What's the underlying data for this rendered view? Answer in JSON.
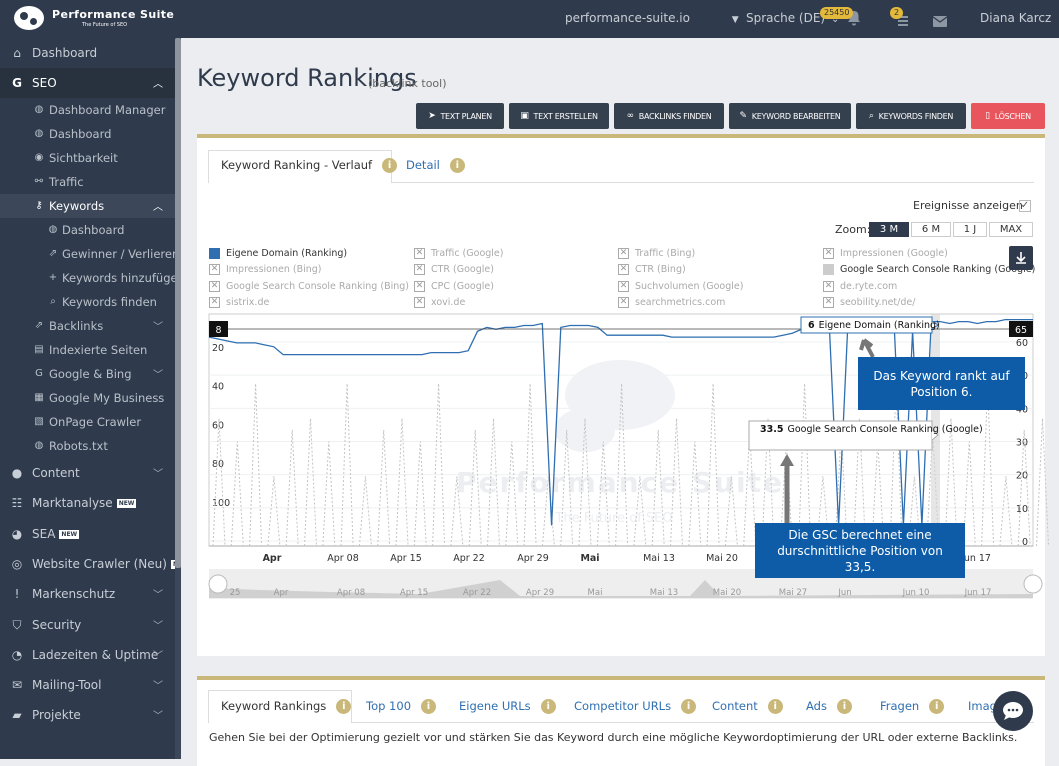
{
  "topbar": {
    "logo_title": "Performance Suite",
    "logo_sub": "The Future of SEO",
    "domain": "performance-suite.io",
    "language": "Sprache (DE)",
    "notif_count": "25450",
    "task_count": "2",
    "user": "Diana Karcz"
  },
  "sidebar": {
    "dashboard": "Dashboard",
    "seo": "SEO",
    "seo_items": [
      "Dashboard Manager",
      "Dashboard",
      "Sichtbarkeit",
      "Traffic",
      "Keywords"
    ],
    "keyword_items": [
      "Dashboard",
      "Gewinner / Verlierer",
      "Keywords hinzufügen",
      "Keywords finden"
    ],
    "seo_items2": [
      "Backlinks",
      "Indexierte Seiten",
      "Google & Bing",
      "Google My Business",
      "OnPage Crawler",
      "Robots.txt"
    ],
    "main_items": [
      "Content",
      "Marktanalyse",
      "SEA",
      "Website Crawler (Neu)",
      "Markenschutz",
      "Security",
      "Ladezeiten & Uptime",
      "Mailing-Tool",
      "Projekte"
    ],
    "new_label": "NEW"
  },
  "page": {
    "title": "Keyword Rankings",
    "subtitle": "(backlink tool)"
  },
  "toolbar": {
    "buttons": [
      "TEXT PLANEN",
      "TEXT ERSTELLEN",
      "BACKLINKS FINDEN",
      "KEYWORD BEARBEITEN",
      "KEYWORDS FINDEN",
      "LÖSCHEN"
    ],
    "delete_color": "#e8555c"
  },
  "card1": {
    "tabs": [
      "Keyword Ranking - Verlauf",
      "Detail"
    ],
    "events_label": "Ereignisse anzeigen",
    "zoom_label": "Zoom:",
    "zoom_options": [
      "3 M",
      "6 M",
      "1 J",
      "MAX"
    ],
    "zoom_selected": "3 M",
    "legend": [
      [
        "Eigene Domain (Ranking)",
        "Traffic (Google)",
        "Traffic (Bing)",
        "Impressionen (Google)"
      ],
      [
        "Impressionen (Bing)",
        "CTR (Google)",
        "CTR (Bing)",
        "Google Search Console Ranking (Google)"
      ],
      [
        "Google Search Console Ranking (Bing)",
        "CPC (Google)",
        "Suchvolumen (Google)",
        "de.ryte.com"
      ],
      [
        "sistrix.de",
        "xovi.de",
        "searchmetrics.com",
        "seobility.net/de/"
      ]
    ]
  },
  "chart_data": {
    "type": "line",
    "x_labels": [
      "Apr",
      "Apr 08",
      "Apr 15",
      "Apr 22",
      "Apr 29",
      "Mai",
      "Mai 13",
      "Mai 20",
      "Mai 27",
      "Jun",
      "Jun 10",
      "Jun 17"
    ],
    "navigator_labels": [
      "25",
      "Apr",
      "Apr 08",
      "Apr 15",
      "Apr 22",
      "Apr 29",
      "Mai",
      "Mai 13",
      "Mai 20",
      "Mai 27",
      "Jun",
      "Jun 10",
      "Jun 17"
    ],
    "y_left_ticks": [
      "20",
      "40",
      "60",
      "80",
      "100"
    ],
    "y_right_ticks": [
      "60",
      "50",
      "40",
      "30",
      "20",
      "10",
      "0"
    ],
    "left_marker": "8",
    "right_marker": "65",
    "series": [
      {
        "name": "Eigene Domain (Ranking)",
        "color": "#2f6fb1",
        "values": [
          15,
          16,
          17,
          18,
          18,
          18,
          19,
          20,
          24,
          24,
          24,
          24,
          24,
          24,
          24,
          24,
          24,
          24,
          24,
          24,
          24,
          24,
          24,
          24,
          23,
          23,
          23,
          23,
          22,
          12,
          10,
          11,
          10,
          10,
          9,
          9,
          8,
          112,
          10,
          9,
          9,
          9,
          10,
          14,
          14,
          14,
          14,
          14,
          14,
          14,
          15,
          15,
          15,
          15,
          15,
          15,
          15,
          15,
          15,
          15,
          15,
          15,
          14,
          13,
          11,
          10,
          9,
          9,
          112,
          9,
          8,
          8,
          8,
          8,
          8,
          112,
          12,
          112,
          7,
          7,
          8,
          7,
          7,
          8,
          7,
          7,
          6,
          6,
          6,
          6
        ]
      }
    ],
    "tooltips": [
      {
        "value": "6",
        "label": "Eigene Domain (Ranking)"
      },
      {
        "value": "33.5",
        "label": "Google Search Console Ranking (Google)"
      }
    ]
  },
  "annotations": {
    "a1": "Das Keyword rankt auf Position 6.",
    "a2": "Die GSC berechnet eine durschnittliche Position von 33,5."
  },
  "watermark": {
    "title": "Performance Suite",
    "sub": "The Future of SEO"
  },
  "card2": {
    "tabs": [
      "Keyword Rankings",
      "Top 100",
      "Eigene URLs",
      "Competitor URLs",
      "Content",
      "Ads",
      "Fragen",
      "Images"
    ],
    "description": "Gehen Sie bei der Optimierung gezielt vor und stärken Sie das Keyword durch eine mögliche Keywordoptimierung der URL oder externe Backlinks."
  },
  "colors": {
    "navy": "#2f3b4c",
    "gold": "#c9b87a",
    "blue": "#2f6fb1",
    "annotation": "#0e5ca8"
  }
}
